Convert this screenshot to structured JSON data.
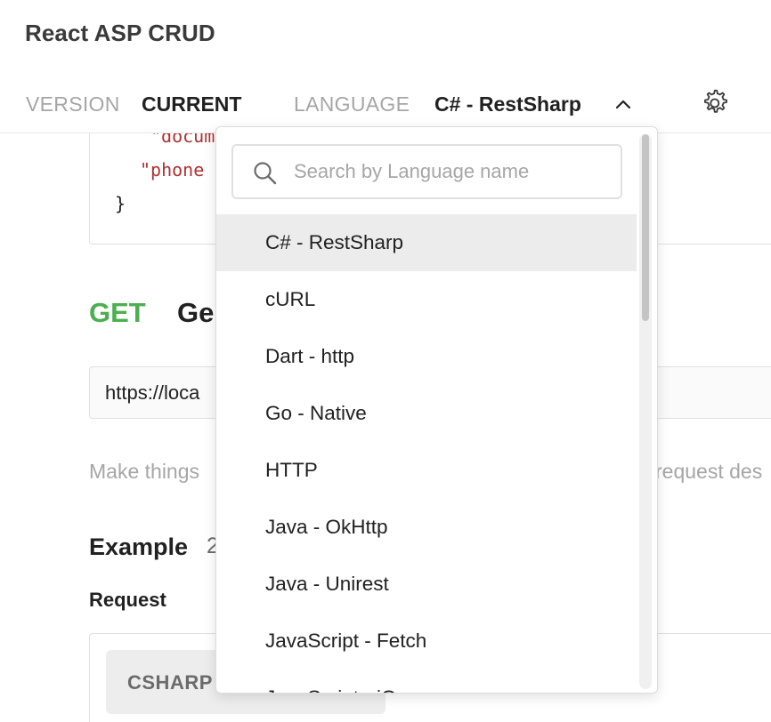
{
  "app": {
    "title": "React ASP CRUD"
  },
  "meta_bar": {
    "version_label": "VERSION",
    "version_value": "CURRENT",
    "language_label": "LANGUAGE",
    "language_value": "C# - RestSharp",
    "chevron_icon": "chevron-up-icon",
    "settings_icon": "gear-icon"
  },
  "background": {
    "code_lines": [
      "\"docum",
      "\"phone",
      "}"
    ],
    "request": {
      "method": "GET",
      "name_fragment": "Ge"
    },
    "url_fragment": "https://loca",
    "description_left": "Make things",
    "description_right": "request des",
    "example": {
      "title": "Example",
      "count_fragment": "2"
    },
    "request_label": "Request",
    "language_chip": "CSHARP"
  },
  "dropdown": {
    "search": {
      "placeholder": "Search by Language name",
      "value": "",
      "icon": "search-icon"
    },
    "options": [
      "C# - RestSharp",
      "cURL",
      "Dart - http",
      "Go - Native",
      "HTTP",
      "Java - OkHttp",
      "Java - Unirest",
      "JavaScript - Fetch",
      "JavaScript - jQuery"
    ],
    "selected_option": "C# - RestSharp"
  },
  "colors": {
    "get_method": "#4caf50",
    "code_string": "#b03030",
    "muted_text": "#a6a6a6",
    "selected_row": "#ececec"
  }
}
